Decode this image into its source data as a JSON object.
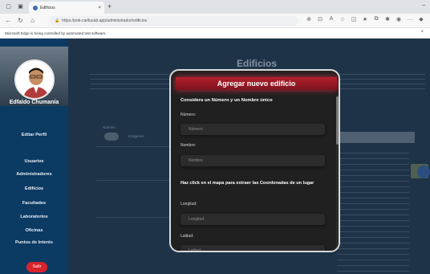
{
  "browser": {
    "tab_title": "Edificios",
    "url": "https://pok-carlluoab.app/administrador/edificios",
    "automation_notice": "Microsoft Edge is being controlled by automated test software."
  },
  "sidebar": {
    "user_name": "Edfaldo Chumanía",
    "profile_link": "Editar Perfil",
    "items": [
      {
        "label": "Usuarios"
      },
      {
        "label": "Administradores"
      },
      {
        "label": "Edificios"
      },
      {
        "label": "Facultades"
      },
      {
        "label": "Laboratorios"
      },
      {
        "label": "Oficinas"
      },
      {
        "label": "Puntos de Interés"
      }
    ],
    "exit_label": "Salir"
  },
  "background": {
    "title": "Edificios",
    "col_number": "Número",
    "col_images": "Imágenes"
  },
  "modal": {
    "title": "Agregar nuevo edificio",
    "subtitle": "Considera un Número y un Nombre único",
    "number_label": "Número:",
    "number_placeholder": "Número",
    "name_label": "Nombre:",
    "name_placeholder": "Nombre",
    "map_instruction": "Haz click en el mapa para extraer las Coordenadas de un lugar",
    "lon_label": "Longitud:",
    "lon_placeholder": "Longitud",
    "lat_label": "Latitud:",
    "lat_placeholder": "Latitud"
  },
  "colors": {
    "modal_header": "#b21f2c",
    "sidebar": "#0b3a63",
    "exit_button": "#d8232a"
  }
}
